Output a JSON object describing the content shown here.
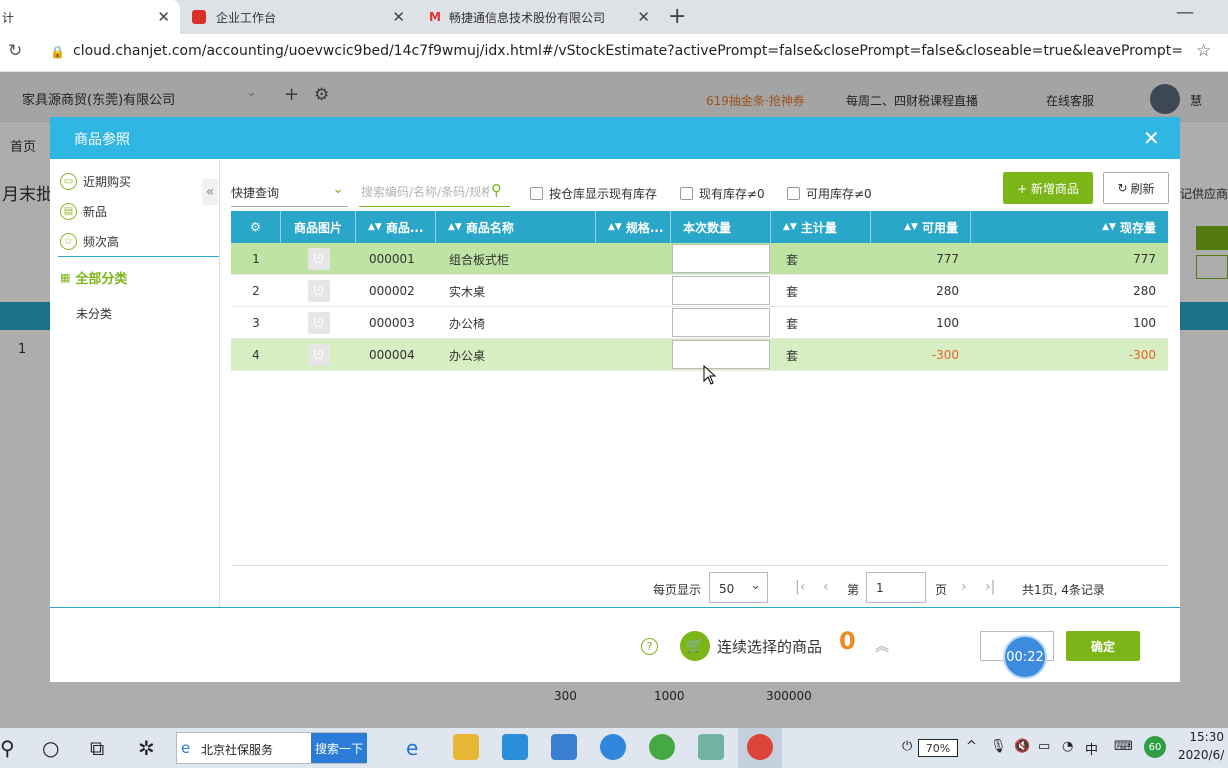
{
  "browser": {
    "tabs": [
      {
        "label": "计",
        "active": true
      },
      {
        "label": "企业工作台",
        "active": false
      },
      {
        "label": "畅捷通信息技术股份有限公司",
        "active": false
      }
    ],
    "url": "cloud.chanjet.com/accounting/uoevwcic9bed/14c7f9wmuj/idx.html#/vStockEstimate?activePrompt=false&closePrompt=false&closeable=true&leavePrompt=false..."
  },
  "app": {
    "company": "家具源商贸(东莞)有限公司",
    "promo": "619抽金条·抢神券",
    "course": "每周二、四财税课程直播",
    "service": "在线客服",
    "user": "慧",
    "nav_home": "首页",
    "bg_title": "月末批",
    "bg_supplier": "记供应商",
    "bg_row1": "1",
    "bg_footer": [
      "300",
      "1000",
      "300000"
    ]
  },
  "modal": {
    "title": "商品参照",
    "sidebar": {
      "items": [
        {
          "label": "近期购买",
          "icon": "bag-icon"
        },
        {
          "label": "新品",
          "icon": "new-icon"
        },
        {
          "label": "频次高",
          "icon": "star-icon"
        }
      ],
      "all_categories": "全部分类",
      "uncategorized": "未分类"
    },
    "toolbar": {
      "quick_query": "快捷查询",
      "search_placeholder": "搜索编码/名称/条码/规格",
      "cb_by_warehouse": "按仓库显示现有库存",
      "cb_stock_nonzero": "现有库存≠0",
      "cb_available_nonzero": "可用库存≠0",
      "new_product": "+ 新增商品",
      "refresh": "刷新"
    },
    "table": {
      "columns": [
        "商品图片",
        "商品...",
        "商品名称",
        "规格...",
        "本次数量",
        "主计量",
        "可用量",
        "现存量"
      ],
      "rows": [
        {
          "idx": "1",
          "code": "000001",
          "name": "组合板式柜",
          "unit": "套",
          "available": "777",
          "stock": "777"
        },
        {
          "idx": "2",
          "code": "000002",
          "name": "实木桌",
          "unit": "套",
          "available": "280",
          "stock": "280"
        },
        {
          "idx": "3",
          "code": "000003",
          "name": "办公椅",
          "unit": "套",
          "available": "100",
          "stock": "100"
        },
        {
          "idx": "4",
          "code": "000004",
          "name": "办公桌",
          "unit": "套",
          "available": "-300",
          "stock": "-300"
        }
      ]
    },
    "pager": {
      "per_page_label": "每页显示",
      "per_page": "50",
      "page_prefix": "第",
      "page": "1",
      "page_suffix": "页",
      "summary": "共1页, 4条记录"
    },
    "footer": {
      "continuous_label": "连续选择的商品",
      "count": "0",
      "timer": "00:22",
      "confirm": "确定"
    }
  },
  "taskbar": {
    "search_label": "北京社保服务",
    "search_button": "搜索一下",
    "battery": "70%",
    "badge": "60",
    "ime": "中",
    "time": "15:30",
    "date": "2020/6/1"
  },
  "colors": {
    "accent_blue": "#2fb6e2",
    "accent_green": "#7cb518",
    "negative": "#e8642b",
    "orange": "#f08a24"
  }
}
